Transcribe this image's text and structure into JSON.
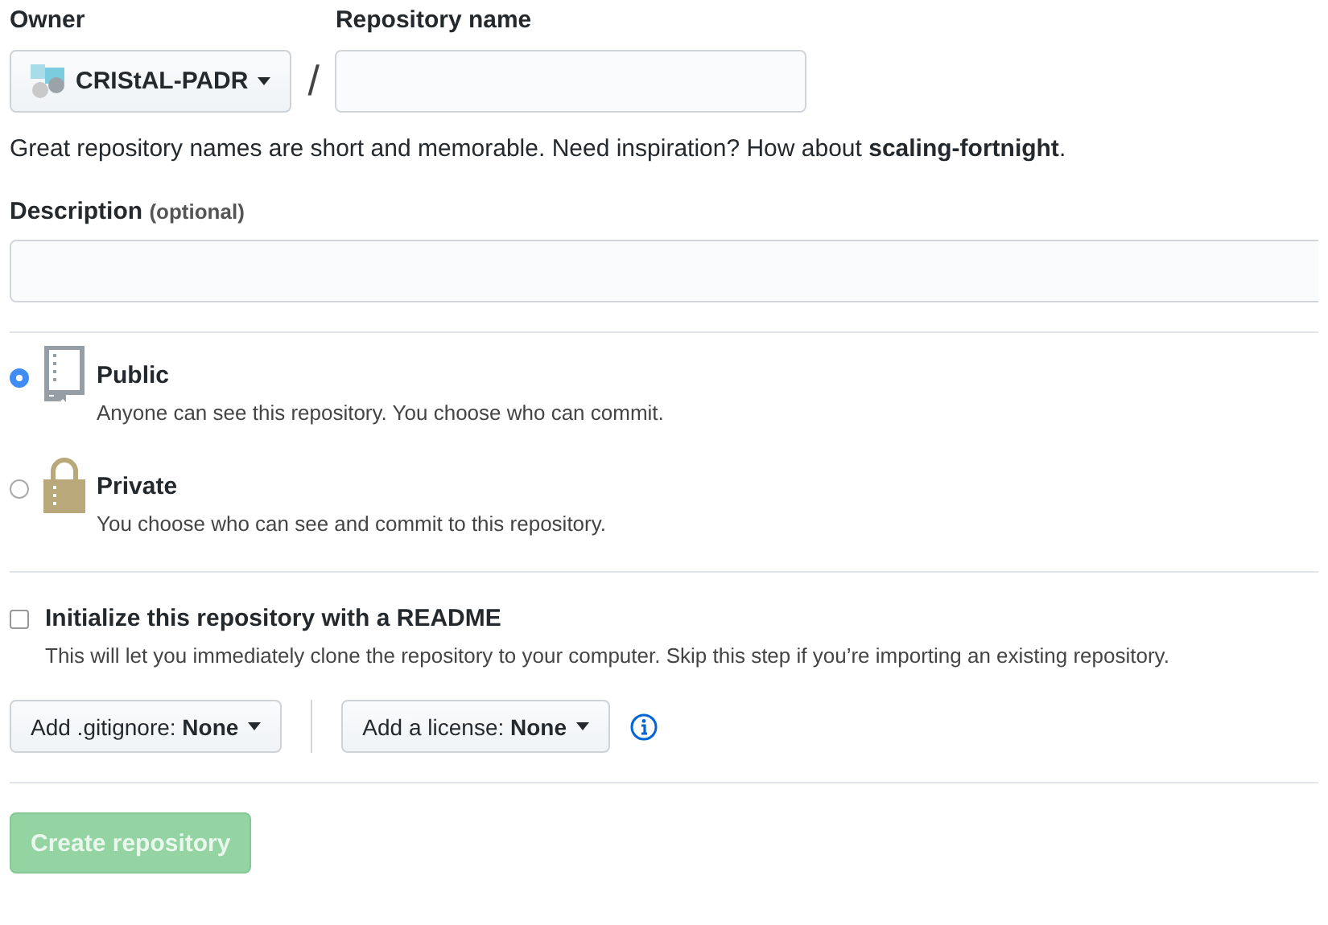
{
  "owner": {
    "label": "Owner",
    "value": "CRIStAL-PADR"
  },
  "repository_name": {
    "label": "Repository name",
    "separator": "/"
  },
  "name_hint": "Great repository names are short and memorable. Need inspiration? How about **scaling-fortnight**.",
  "description": {
    "label": "Description",
    "note": "(optional)"
  },
  "visibility": [
    {
      "kind": "public",
      "title": "Public",
      "text": "Anyone can see this repository. You choose who can commit.",
      "selected": true
    },
    {
      "kind": "private",
      "title": "Private",
      "text": "You choose who can see and commit to this repository.",
      "selected": false
    }
  ],
  "readme": {
    "label": "Initialize this repository with a README",
    "text": "This will let you immediately clone the repository to your computer. Skip this step if you’re importing an existing repository.",
    "checked": false
  },
  "dropdowns": [
    "Add .gitignore: **None**",
    "Add a license: **None**"
  ],
  "create_button": {
    "label": "Create repository",
    "disabled": true
  }
}
